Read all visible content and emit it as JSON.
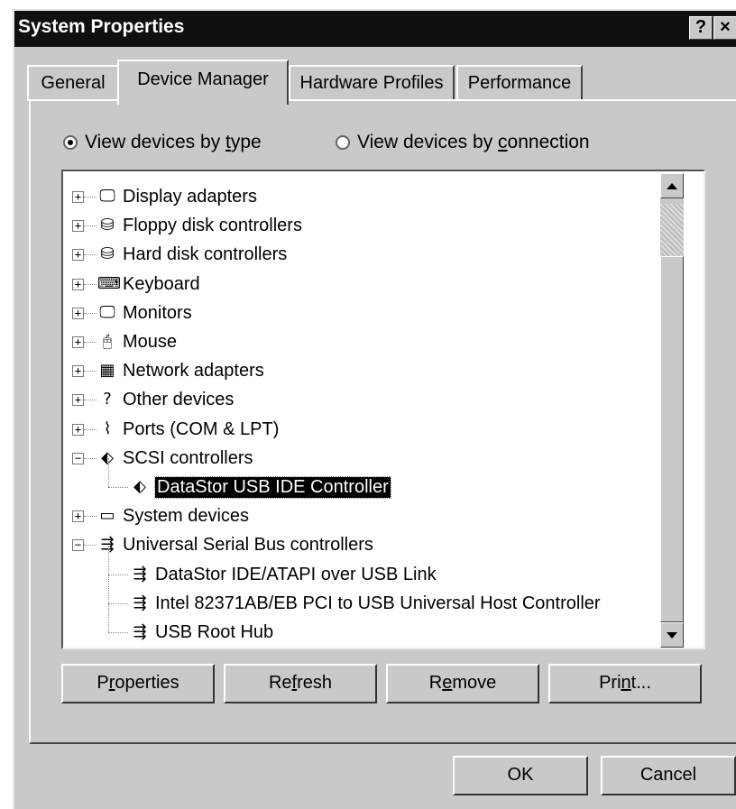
{
  "window": {
    "title": "System Properties",
    "help_label": "?",
    "close_label": "×"
  },
  "tabs": [
    {
      "label": "General"
    },
    {
      "label": "Device Manager"
    },
    {
      "label": "Hardware Profiles"
    },
    {
      "label": "Performance"
    }
  ],
  "view_options": {
    "by_type_pre": "View devices by ",
    "by_type_key": "t",
    "by_type_post": "ype",
    "by_conn_pre": "View devices by ",
    "by_conn_key": "c",
    "by_conn_post": "onnection",
    "selected": "type"
  },
  "device_tree": [
    {
      "label": "Display adapters",
      "icon": "monitor-icon",
      "glyph": "🖵",
      "expander": "+"
    },
    {
      "label": "Floppy disk controllers",
      "icon": "drive-icon",
      "glyph": "⛁",
      "expander": "+"
    },
    {
      "label": "Hard disk controllers",
      "icon": "drive-icon",
      "glyph": "⛁",
      "expander": "+"
    },
    {
      "label": "Keyboard",
      "icon": "keyboard-icon",
      "glyph": "⌨",
      "expander": "+"
    },
    {
      "label": "Monitors",
      "icon": "monitor-icon",
      "glyph": "🖵",
      "expander": "+"
    },
    {
      "label": "Mouse",
      "icon": "mouse-icon",
      "glyph": "🖰",
      "expander": "+"
    },
    {
      "label": "Network adapters",
      "icon": "network-card-icon",
      "glyph": "▦",
      "expander": "+"
    },
    {
      "label": "Other devices",
      "icon": "question-icon",
      "glyph": "?",
      "expander": "+"
    },
    {
      "label": "Ports (COM & LPT)",
      "icon": "port-icon",
      "glyph": "⌇",
      "expander": "+"
    },
    {
      "label": "SCSI controllers",
      "icon": "scsi-icon",
      "glyph": "⬖",
      "expander": "−"
    },
    {
      "label": "DataStor USB IDE Controller",
      "icon": "scsi-icon",
      "glyph": "⬖",
      "child": true,
      "selected": true
    },
    {
      "label": "System devices",
      "icon": "computer-icon",
      "glyph": "▭",
      "expander": "+"
    },
    {
      "label": "Universal Serial Bus controllers",
      "icon": "usb-icon",
      "glyph": "⇶",
      "expander": "−"
    },
    {
      "label": "DataStor IDE/ATAPI over USB Link",
      "icon": "usb-icon",
      "glyph": "⇶",
      "child": true
    },
    {
      "label": "Intel 82371AB/EB PCI to USB Universal Host Controller",
      "icon": "usb-icon",
      "glyph": "⇶",
      "child": true
    },
    {
      "label": "USB Root Hub",
      "icon": "usb-icon",
      "glyph": "⇶",
      "child": true
    }
  ],
  "buttons": {
    "properties": {
      "pre": "P",
      "key": "r",
      "post": "operties"
    },
    "refresh": {
      "pre": "Re",
      "key": "f",
      "post": "resh"
    },
    "remove": {
      "pre": "R",
      "key": "e",
      "post": "move"
    },
    "print": {
      "pre": "Pri",
      "key": "n",
      "post": "t..."
    },
    "ok": "OK",
    "cancel": "Cancel"
  }
}
